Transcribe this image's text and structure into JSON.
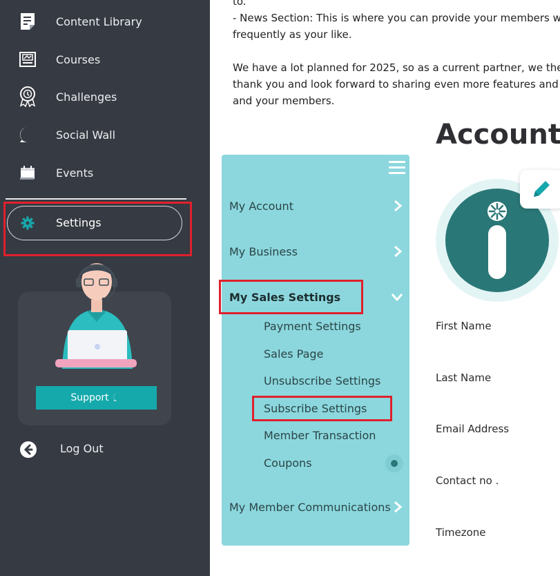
{
  "sidebar": {
    "items": [
      {
        "label": "Content Library",
        "icon": "document-icon"
      },
      {
        "label": "Courses",
        "icon": "certificate-icon"
      },
      {
        "label": "Challenges",
        "icon": "award-ribbon-icon"
      },
      {
        "label": "Social Wall",
        "icon": "chat-bubble-icon"
      },
      {
        "label": "Events",
        "icon": "calendar-icon"
      }
    ],
    "settings_label": "Settings",
    "support_label": "Support",
    "logout_label": "Log Out"
  },
  "main_text": {
    "line1": "to.",
    "line2": "- News Section: This is where you can provide your members w",
    "line3": "frequently as your like.",
    "line4": "We have a lot planned for 2025, so as a current partner, we the",
    "line5": "thank you and look forward to sharing even more features and",
    "line6": "and your members."
  },
  "settings_menu": {
    "my_account": "My Account",
    "my_business": "My Business",
    "my_sales_settings": "My Sales Settings",
    "sub_items": [
      "Payment Settings",
      "Sales Page",
      "Unsubscribe Settings",
      "Subscribe Settings",
      "Member Transaction",
      "Coupons"
    ],
    "my_member_communications": "My Member Communications"
  },
  "account": {
    "title": "Account",
    "fields": [
      "First Name",
      "Last Name",
      "Email Address",
      "Contact no .",
      "Timezone"
    ]
  },
  "colors": {
    "sidebar_bg": "#363a42",
    "menu_panel_bg": "#8bd7dd",
    "accent_teal": "#15a9ab",
    "avatar_teal": "#2a7777",
    "highlight_red": "#e0202c"
  }
}
